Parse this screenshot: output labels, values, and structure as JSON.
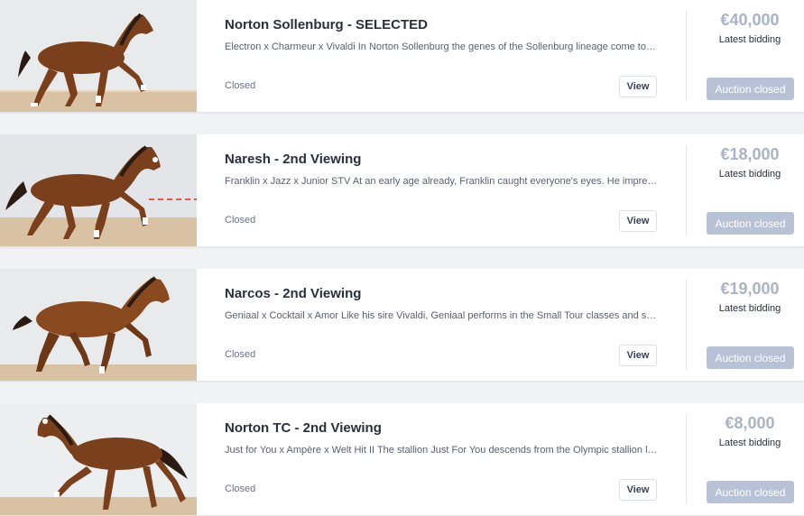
{
  "listings": [
    {
      "title": "Norton Sollenburg - SELECTED",
      "description": "Electron x Charmeur x Vivaldi In Norton Sollenburg the genes of the Sollenburg lineage come together in a powerful stallion",
      "status": "Closed",
      "view_label": "View",
      "price": "€40,000",
      "price_label": "Latest bidding",
      "auction_label": "Auction closed",
      "image_icon": "horse-photo-icon"
    },
    {
      "title": "Naresh - 2nd Viewing",
      "description": "Franklin x Jazz x Junior STV At an early age already, Franklin caught everyone's eyes. He impressed with his movement",
      "status": "Closed",
      "view_label": "View",
      "price": "€18,000",
      "price_label": "Latest bidding",
      "auction_label": "Auction closed",
      "image_icon": "horse-photo-icon"
    },
    {
      "title": "Narcos - 2nd Viewing",
      "description": "Geniaal x Cocktail x Amor Like his sire Vivaldi, Geniaal performs in the Small Tour classes and shows great talent",
      "status": "Closed",
      "view_label": "View",
      "price": "€19,000",
      "price_label": "Latest bidding",
      "auction_label": "Auction closed",
      "image_icon": "horse-photo-icon"
    },
    {
      "title": "Norton TC - 2nd Viewing",
      "description": "Just for You x Ampère x Welt Hit II The stallion Just For You descends from the Olympic stallion lineage of champions",
      "status": "Closed",
      "view_label": "View",
      "price": "€8,000",
      "price_label": "Latest bidding",
      "auction_label": "Auction closed",
      "image_icon": "horse-photo-icon"
    }
  ],
  "colors": {
    "horse_body": "#7a3f1c",
    "horse_dark": "#2a1a12",
    "arena_sand": "#d9c2a3",
    "wall": "#e9eaec",
    "price": "#aab3c5",
    "closed_button": "#b8c2d6"
  }
}
